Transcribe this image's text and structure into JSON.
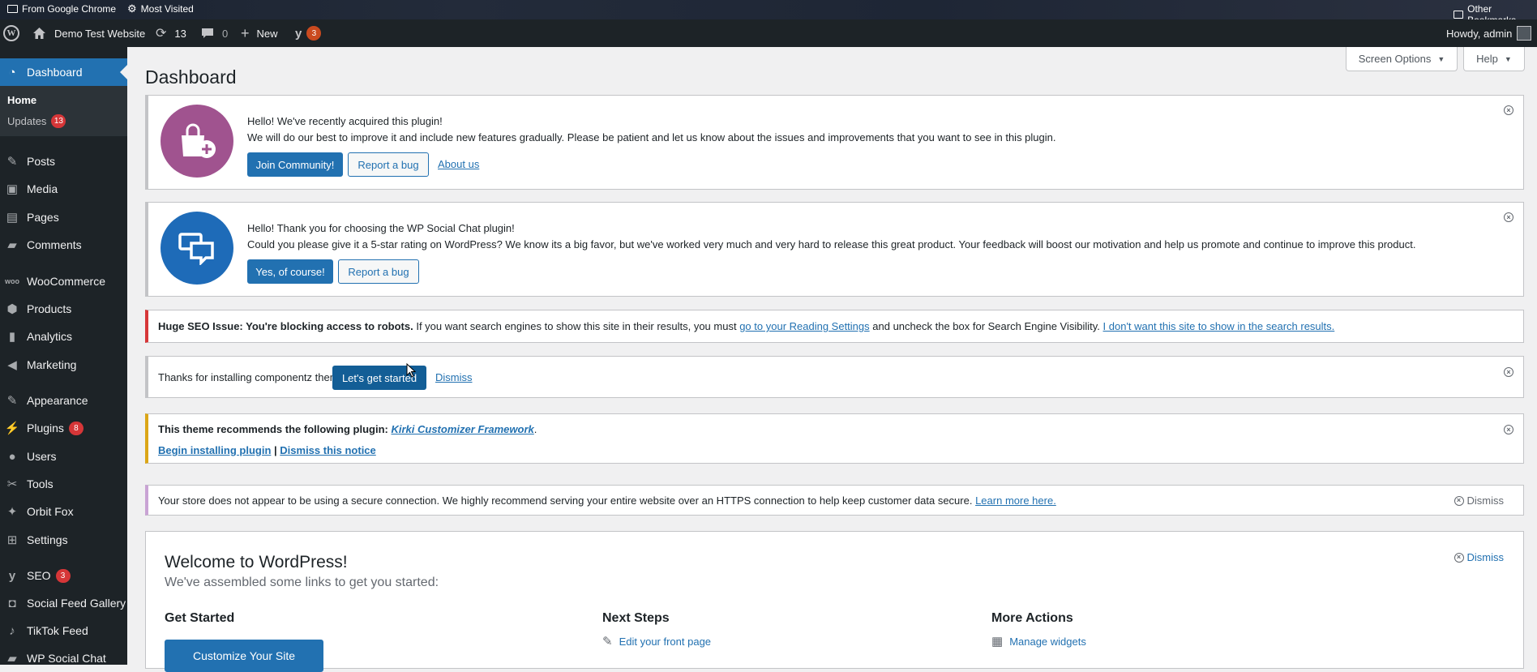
{
  "bookmarks": {
    "from_chrome": "From Google Chrome",
    "most_visited": "Most Visited",
    "other": "Other Bookmarks"
  },
  "adminbar": {
    "site_name": "Demo Test Website",
    "updates_count": "13",
    "comments_count": "0",
    "new_label": "New",
    "yoast_count": "3",
    "howdy": "Howdy, admin"
  },
  "sidebar": {
    "dashboard": "Dashboard",
    "sub_home": "Home",
    "sub_updates": "Updates",
    "sub_updates_count": "13",
    "items": [
      {
        "label": "Posts"
      },
      {
        "label": "Media"
      },
      {
        "label": "Pages"
      },
      {
        "label": "Comments"
      },
      {
        "label": "WooCommerce"
      },
      {
        "label": "Products"
      },
      {
        "label": "Analytics"
      },
      {
        "label": "Marketing"
      },
      {
        "label": "Appearance"
      },
      {
        "label": "Plugins",
        "count": "8"
      },
      {
        "label": "Users"
      },
      {
        "label": "Tools"
      },
      {
        "label": "Orbit Fox"
      },
      {
        "label": "Settings"
      },
      {
        "label": "SEO",
        "count": "3"
      },
      {
        "label": "Social Feed Gallery"
      },
      {
        "label": "TikTok Feed"
      },
      {
        "label": "WP Social Chat"
      }
    ]
  },
  "main": {
    "title": "Dashboard",
    "screen_options": "Screen Options",
    "help": "Help",
    "notice1": {
      "line1": "Hello! We've recently acquired this plugin!",
      "line2": "We will do our best to improve it and include new features gradually. Please be patient and let us know about the issues and improvements that you want to see in this plugin.",
      "btn_join": "Join Community!",
      "btn_report": "Report a bug",
      "link_about": "About us"
    },
    "notice2": {
      "line1": "Hello! Thank you for choosing the WP Social Chat plugin!",
      "line2": "Could you please give it a 5-star rating on WordPress? We know its a big favor, but we've worked very much and very hard to release this great product. Your feedback will boost our motivation and help us promote and continue to improve this product.",
      "btn_yes": "Yes, of course!",
      "btn_report": "Report a bug"
    },
    "seo_notice": {
      "bold": "Huge SEO Issue: You're blocking access to robots.",
      "text1": "If you want search engines to show this site in their results, you must",
      "link1": "go to your Reading Settings",
      "text2": "and uncheck the box for Search Engine Visibility.",
      "link2": "I don't want this site to show in the search results."
    },
    "theme_notice": {
      "text": "Thanks for installing componentz theme",
      "btn": "Let's get started",
      "dismiss": "Dismiss"
    },
    "plugin_notice": {
      "text": "This theme recommends the following plugin:",
      "plugin": "Kirki Customizer Framework",
      "period": ".",
      "begin": "Begin installing plugin",
      "sep": "|",
      "dismiss": "Dismiss this notice"
    },
    "https_notice": {
      "text": "Your store does not appear to be using a secure connection. We highly recommend serving your entire website over an HTTPS connection to help keep customer data secure.",
      "link": "Learn more here.",
      "dismiss": "Dismiss"
    },
    "welcome": {
      "title": "Welcome to WordPress!",
      "subtitle": "We've assembled some links to get you started:",
      "dismiss": "Dismiss",
      "col1_title": "Get Started",
      "col1_btn": "Customize Your Site",
      "col2_title": "Next Steps",
      "col2_link": "Edit your front page",
      "col3_title": "More Actions",
      "col3_link": "Manage widgets"
    }
  },
  "colors": {
    "admin_bg": "#1d2327",
    "accent": "#2271b1",
    "badge": "#d63638",
    "notice_error": "#d63638",
    "notice_warning": "#dba617",
    "notice_woo": "#c9a3d4"
  }
}
